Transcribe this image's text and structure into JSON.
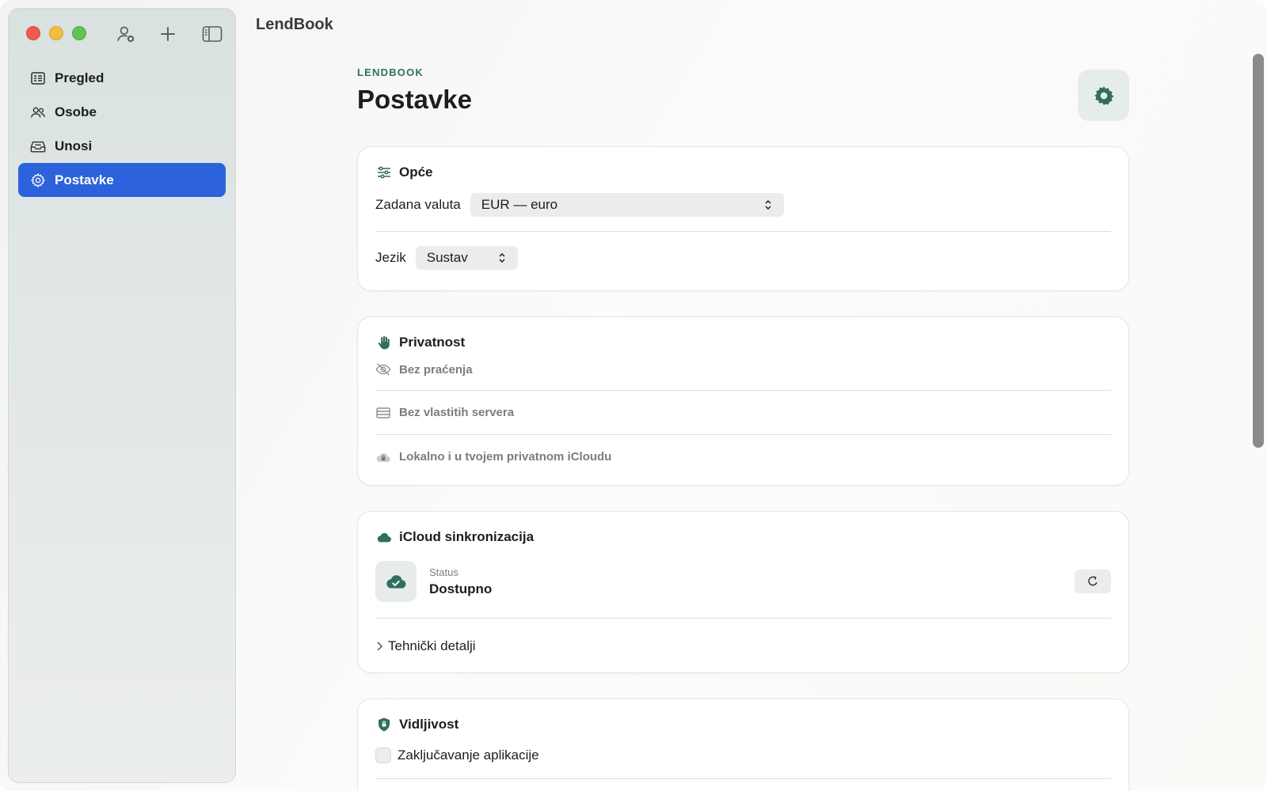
{
  "window": {
    "app_title": "LendBook",
    "toolbar_icons": [
      "add-person-icon",
      "plus-icon",
      "sidebar-toggle-icon"
    ]
  },
  "sidebar": {
    "items": [
      {
        "label": "Pregled",
        "icon": "overview-icon",
        "active": false
      },
      {
        "label": "Osobe",
        "icon": "people-icon",
        "active": false
      },
      {
        "label": "Unosi",
        "icon": "inbox-icon",
        "active": false
      },
      {
        "label": "Postavke",
        "icon": "gear-icon",
        "active": true
      }
    ]
  },
  "header": {
    "eyebrow": "LENDBOOK",
    "title": "Postavke"
  },
  "general": {
    "title": "Opće",
    "currency_label": "Zadana valuta",
    "currency_value": "EUR — euro",
    "language_label": "Jezik",
    "language_value": "Sustav"
  },
  "privacy": {
    "title": "Privatnost",
    "items": [
      {
        "label": "Bez praćenja",
        "icon": "eye-slash-icon"
      },
      {
        "label": "Bez vlastitih servera",
        "icon": "server-icon"
      },
      {
        "label": "Lokalno i u tvojem privatnom iCloudu",
        "icon": "lock-cloud-icon"
      }
    ]
  },
  "icloud": {
    "title": "iCloud sinkronizacija",
    "status_label": "Status",
    "status_value": "Dostupno",
    "details_label": "Tehnički detalji"
  },
  "visibility": {
    "title": "Vidljivost",
    "app_lock_label": "Zaključavanje aplikacije"
  },
  "colors": {
    "accent": "#2c63dc",
    "brand_green": "#2f6f62"
  }
}
